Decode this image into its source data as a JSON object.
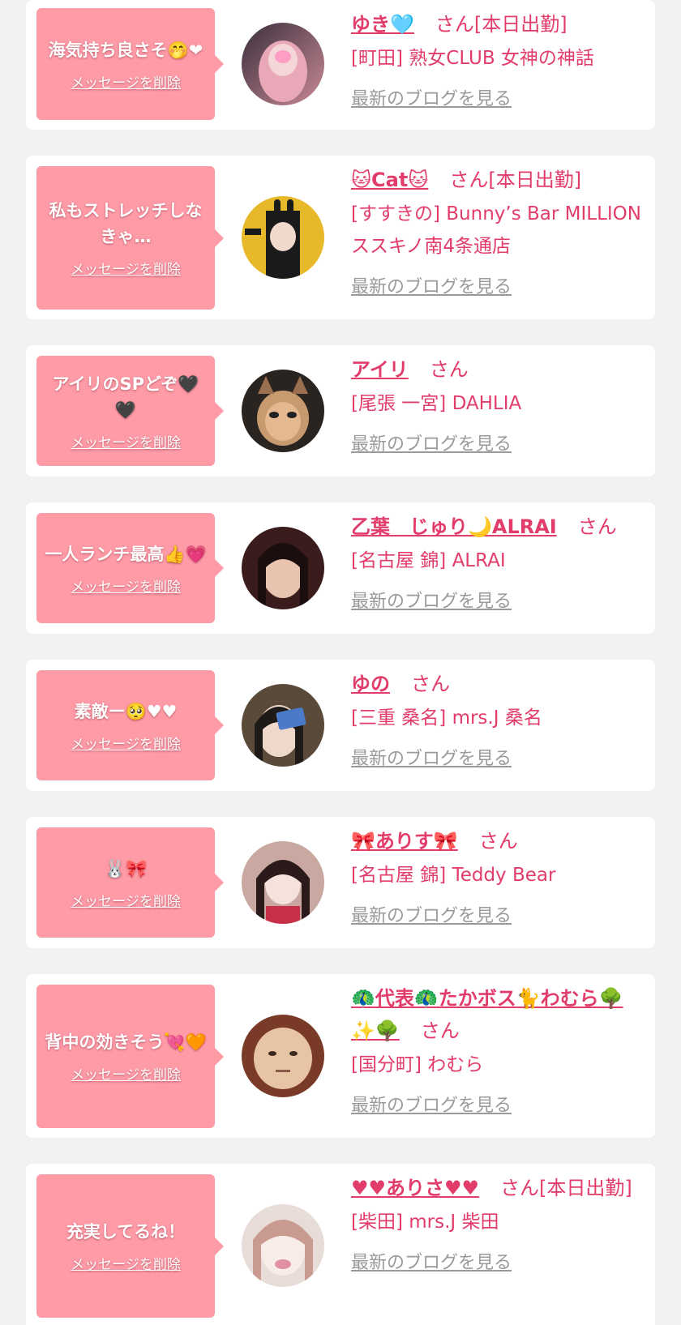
{
  "colors": {
    "page_bg": "#f2f2f2",
    "bubble": "#ff9aa7",
    "accent": "#e23c6a",
    "link_gray": "#9a9a9a"
  },
  "delete_label": "メッセージを削除",
  "blog_label": "最新のブログを見る",
  "messages": [
    {
      "message": "海気持ち良さそ🤭❤",
      "name": "ゆき🩵",
      "honorific": "さん[本日出勤]",
      "shop": "[町田] 熟女CLUB 女神の神話"
    },
    {
      "message": "私もストレッチしなきゃ…",
      "name": "🐱Cat🐱",
      "honorific": "さん[本日出勤]",
      "shop": "[すすきの] Bunny’s Bar MILLION ススキノ南4条通店"
    },
    {
      "message": "アイリのSPどぞ🖤🖤",
      "name": "アイリ",
      "honorific": "さん",
      "shop": "[尾張 一宮] DAHLIA"
    },
    {
      "message": "一人ランチ最高👍💗",
      "name": "乙葉　じゅり🌙ALRAI",
      "honorific": "さん",
      "shop": "[名古屋 錦] ALRAI"
    },
    {
      "message": "素敵ー🥺♥♥",
      "name": "ゆの",
      "honorific": "さん",
      "shop": "[三重 桑名] mrs.J 桑名"
    },
    {
      "message": "🐰🎀",
      "name": "🎀ありす🎀",
      "honorific": "さん",
      "shop": "[名古屋 錦] Teddy Bear"
    },
    {
      "message": "背中の効きそう💘🧡",
      "name": "🦚代表🦚たかボス🐈わむら🌳✨🌳",
      "honorific": "さん",
      "shop": "[国分町] わむら"
    },
    {
      "message": "充実してるね！",
      "name": "♥♥ありさ♥♥",
      "honorific": "さん[本日出勤]",
      "shop": "[柴田] mrs.J 柴田"
    }
  ]
}
